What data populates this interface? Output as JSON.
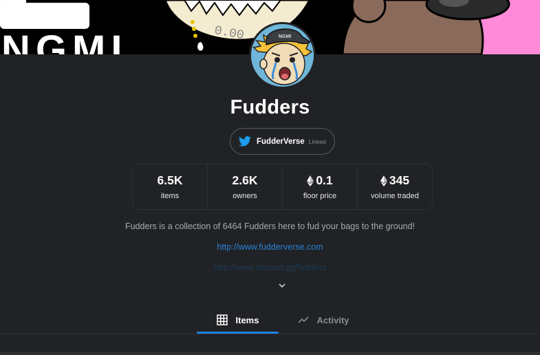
{
  "collection": {
    "name": "Fudders",
    "avatar_icon": "crying-fudder-avatar"
  },
  "twitter": {
    "icon": "twitter-bird-icon",
    "handle": "FudderVerse",
    "status": "Linked",
    "color": "#1d9bf0"
  },
  "stats": [
    {
      "value": "6.5K",
      "label": "items",
      "eth": false
    },
    {
      "value": "2.6K",
      "label": "owners",
      "eth": false
    },
    {
      "value": "0.1",
      "label": "floor price",
      "eth": true
    },
    {
      "value": "345",
      "label": "volume traded",
      "eth": true
    }
  ],
  "description": "Fudders is a collection of 6464 Fudders here to fud your bags to the ground!",
  "links": [
    "http://www.fudderverse.com",
    "http://www.discord.gg/fudders"
  ],
  "banner": {
    "text": "NGMI",
    "coin_text": "0.00"
  },
  "tabs": [
    {
      "label": "Items",
      "icon": "grid-icon",
      "active": true
    },
    {
      "label": "Activity",
      "icon": "trending-line-icon",
      "active": false
    }
  ],
  "colors": {
    "background": "#202225",
    "accent": "#2081e2",
    "link": "#2a82d6",
    "muted_text": "#8a8c91"
  }
}
